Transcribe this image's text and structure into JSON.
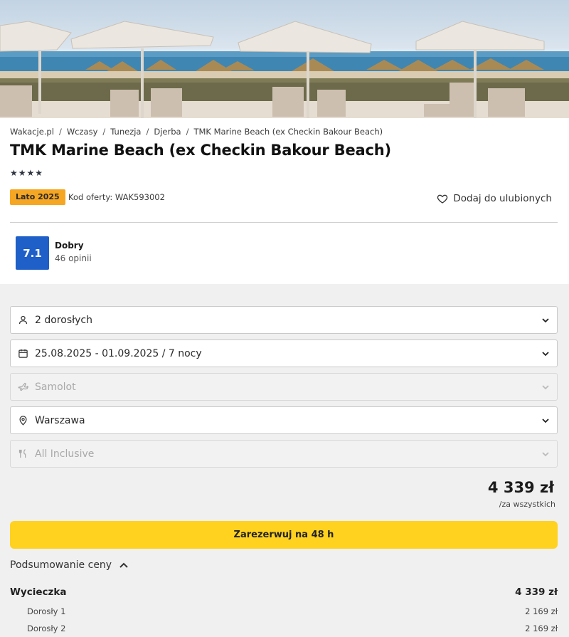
{
  "breadcrumbs": [
    "Wakacje.pl",
    "Wczasy",
    "Tunezja",
    "Djerba",
    "TMK Marine Beach (ex Checkin Bakour Beach)"
  ],
  "hotel": {
    "name": "TMK Marine Beach (ex Checkin Bakour Beach)",
    "stars": "★★★★",
    "star_count": 4,
    "season_badge": "Lato 2025",
    "offer_code": "Kod oferty: WAK593002",
    "favorite_label": "Dodaj do ulubionych"
  },
  "rating": {
    "score": "7.1",
    "label": "Dobry",
    "count": "46 opinii"
  },
  "filters": {
    "travelers": "2 dorosłych",
    "dates": "25.08.2025 - 01.09.2025 / 7 nocy",
    "transport": "Samolot",
    "departure": "Warszawa",
    "board": "All Inclusive"
  },
  "price": {
    "total": "4 339 zł",
    "note": "/za wszystkich"
  },
  "book_button": "Zarezerwuj na 48 h",
  "summary": {
    "toggle_label": "Podsumowanie ceny",
    "trip_label": "Wycieczka",
    "trip_total": "4 339 zł",
    "items": [
      {
        "label": "Dorosły 1",
        "value": "2 169 zł"
      },
      {
        "label": "Dorosły 2",
        "value": "2 169 zł"
      }
    ]
  },
  "colors": {
    "accent_yellow": "#ffd21f",
    "badge_orange": "#f5a623",
    "rating_blue": "#1e5fc8"
  }
}
